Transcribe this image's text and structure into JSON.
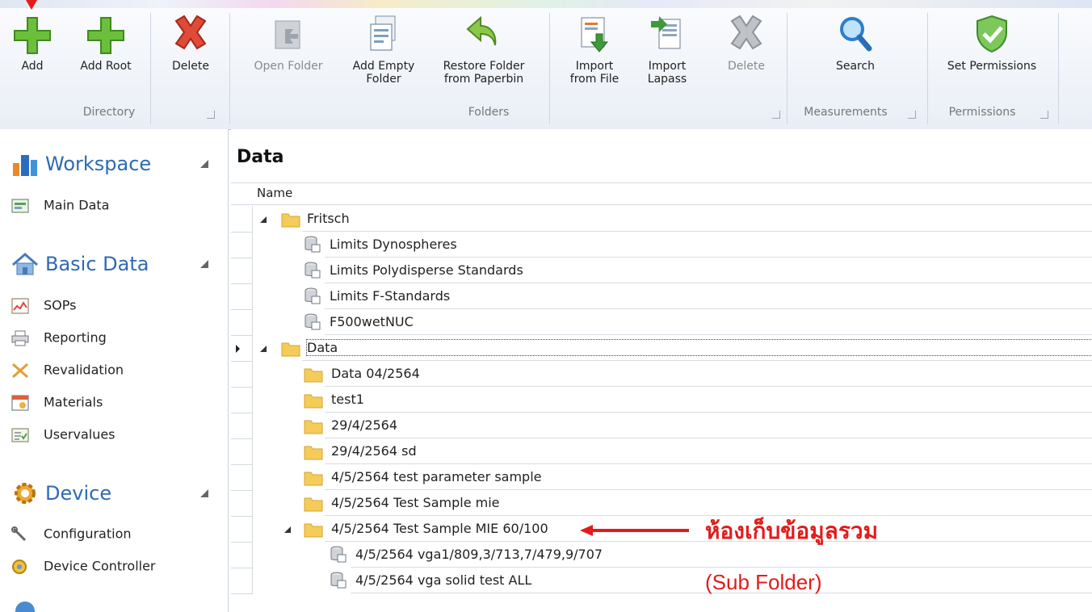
{
  "ribbon": {
    "buttons": {
      "add": "Add",
      "add_root": "Add Root",
      "delete_dir": "Delete",
      "open_folder": "Open Folder",
      "add_empty_folder_1": "Add Empty",
      "add_empty_folder_2": "Folder",
      "restore_1": "Restore Folder",
      "restore_2": "from Paperbin",
      "import_file_1": "Import",
      "import_file_2": "from File",
      "import_lapass_1": "Import",
      "import_lapass_2": "Lapass",
      "delete_folder": "Delete",
      "search": "Search",
      "set_permissions": "Set Permissions"
    },
    "groups": {
      "directory": "Directory",
      "folders": "Folders",
      "measurements": "Measurements",
      "permissions": "Permissions"
    }
  },
  "sidebar": {
    "sections": [
      {
        "label": "Workspace",
        "items": [
          "Main Data"
        ]
      },
      {
        "label": "Basic Data",
        "items": [
          "SOPs",
          "Reporting",
          "Revalidation",
          "Materials",
          "Uservalues"
        ]
      },
      {
        "label": "Device",
        "items": [
          "Configuration",
          "Device Controller"
        ]
      }
    ]
  },
  "main": {
    "title": "Data",
    "column_header": "Name",
    "rows": [
      "Fritsch",
      "Limits  Dynospheres",
      "Limits Polydisperse Standards",
      "Limits F-Standards",
      "F500wetNUC",
      "Data",
      "Data 04/2564",
      "test1",
      "29/4/2564",
      "29/4/2564 sd",
      "4/5/2564 test parameter sample",
      "4/5/2564 Test Sample mie",
      "4/5/2564 Test Sample MIE 60/100",
      "4/5/2564 vga1/809,3/713,7/479,9/707",
      "4/5/2564 vga solid test ALL"
    ]
  },
  "annotation": {
    "line1": "ห้องเก็บข้อมูลรวม",
    "line2": "(Sub Folder)",
    "color": "#e31b1b"
  }
}
